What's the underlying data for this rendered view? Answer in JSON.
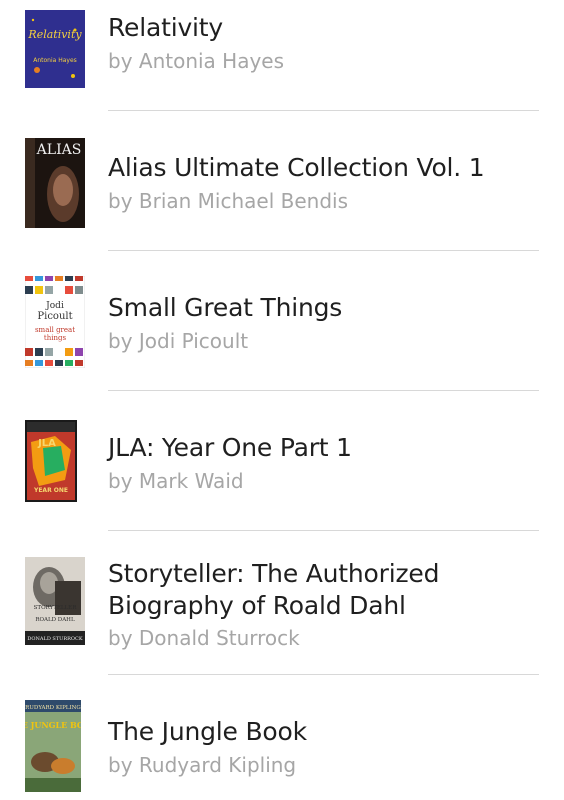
{
  "books": [
    {
      "title": "Relativity",
      "author": "by Antonia Hayes",
      "cover_text": [
        "Relativity",
        "Antonia Hayes"
      ]
    },
    {
      "title": "Alias Ultimate Collection Vol. 1",
      "author": "by Brian Michael Bendis",
      "cover_text": [
        "ALIAS"
      ]
    },
    {
      "title": "Small Great Things",
      "author": "by Jodi Picoult",
      "cover_text": [
        "Jodi",
        "Picoult",
        "small great",
        "things"
      ]
    },
    {
      "title": "JLA: Year One Part 1",
      "author": "by Mark Waid",
      "cover_text": [
        "JLA",
        "YEAR ONE"
      ]
    },
    {
      "title": "Storyteller: The Authorized Biography of Roald Dahl",
      "author": "by Donald Sturrock",
      "cover_text": [
        "STORYTELLER",
        "ROALD DAHL",
        "DONALD STURROCK"
      ]
    },
    {
      "title": "The Jungle Book",
      "author": "by Rudyard Kipling",
      "cover_text": [
        "RUDYARD KIPLING",
        "THE JUNGLE BOOK"
      ]
    }
  ],
  "colors": {
    "title": "#1f1f1f",
    "author": "#a6a6a6",
    "divider": "#d8d8d8"
  }
}
